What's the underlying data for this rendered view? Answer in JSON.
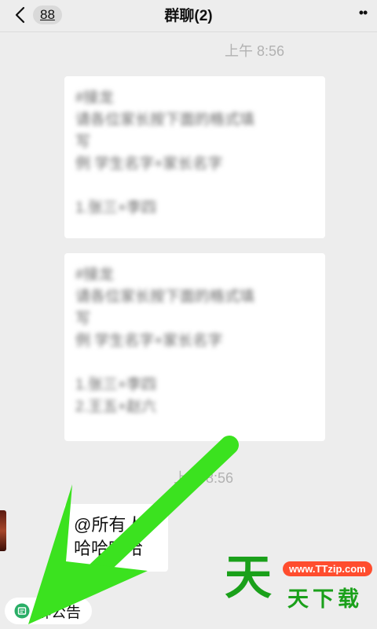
{
  "header": {
    "back_badge": "88",
    "title": "群聊(2)",
    "more": "••"
  },
  "chat": {
    "timestamps": [
      "上午 8:56",
      "上午 8:56"
    ],
    "messages": [
      {
        "lines": [
          "#接龙",
          "请各位家长按下面的格式填",
          "写",
          "例 学生名字+家长名字",
          "",
          "1.张三+李四"
        ]
      },
      {
        "lines": [
          "#接龙",
          "请各位家长按下面的格式填",
          "写",
          "例 学生名字+家长名字",
          "",
          "1.张三+李四",
          "2.王五+赵六"
        ]
      },
      {
        "text": "@所有人 哈哈哈哈"
      }
    ]
  },
  "notice": {
    "label": "群公告"
  },
  "watermark": {
    "big": "天",
    "url": "www.TTzip.com",
    "small": "天下载"
  },
  "colors": {
    "background": "#ededed",
    "bubble": "#ffffff",
    "arrow": "#3be21f",
    "watermark_green": "#1aa01a",
    "watermark_badge": "#ff4d2e"
  }
}
